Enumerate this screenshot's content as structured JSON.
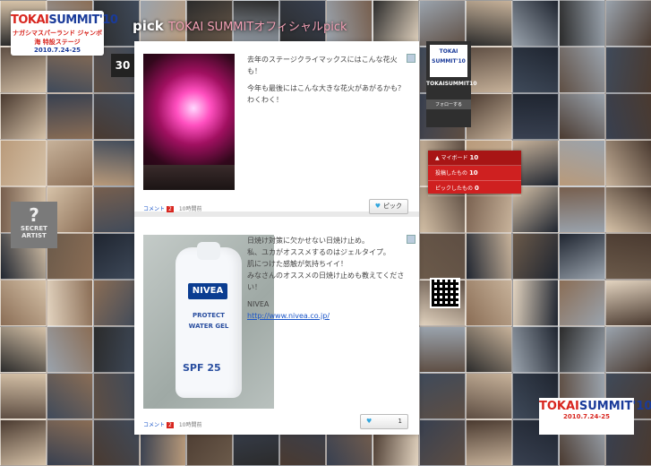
{
  "logo": {
    "line1_a": "TOKAI",
    "line1_b": "SUMMIT'10",
    "line2": "ナガシマスパーランド ジャンボ海 特設ステージ",
    "line3": "2010.7.24-25"
  },
  "pick_title": "pick",
  "pick_subtitle": "TOKAI SUMMITオフィシャルpick",
  "date_badge": "30",
  "secret_artist": {
    "q": "?",
    "line1": "SECRET",
    "line2": "ARTIST"
  },
  "posts": [
    {
      "photo_alt": "fireworks",
      "text": [
        "去年のステージクライマックスにはこんな花火も！",
        "今年も最後にはこんな大きな花火があがるかも？ わくわく！"
      ],
      "comment_label": "コメント",
      "comment_count": "2",
      "time": "10時間前",
      "pick_label": "ピック"
    },
    {
      "photo_alt": "NIVEA sunscreen",
      "product": {
        "brand": "NIVEA",
        "t1": "PROTECT",
        "t2": "WATER GEL",
        "spf": "SPF 25"
      },
      "text": [
        "日焼け対策に欠かせない日焼け止め。",
        "私、ユカがオススメするのはジェルタイプ。",
        "肌につけた感触が気持ちイイ！",
        "みなさんのオススメの日焼け止めも教えてください！",
        "NIVEA"
      ],
      "link": "http://www.nivea.co.jp/",
      "comment_label": "コメント",
      "comment_count": "2",
      "time": "10時間前",
      "pick_count": "1"
    }
  ],
  "profile": {
    "pic_line1": "TOKAI",
    "pic_line2": "SUMMIT'10",
    "name": "TOKAISUMMIT10",
    "follow": "フォローする"
  },
  "menu": {
    "head": "マイボード",
    "head_count": "10",
    "row1": "投稿したもの",
    "row1_count": "10",
    "row2": "ピックしたもの",
    "row2_count": "0"
  },
  "logo2": {
    "line1_a": "TOKAI",
    "line1_b": "SUMMIT'10",
    "line2": "2010.7.24-25"
  }
}
